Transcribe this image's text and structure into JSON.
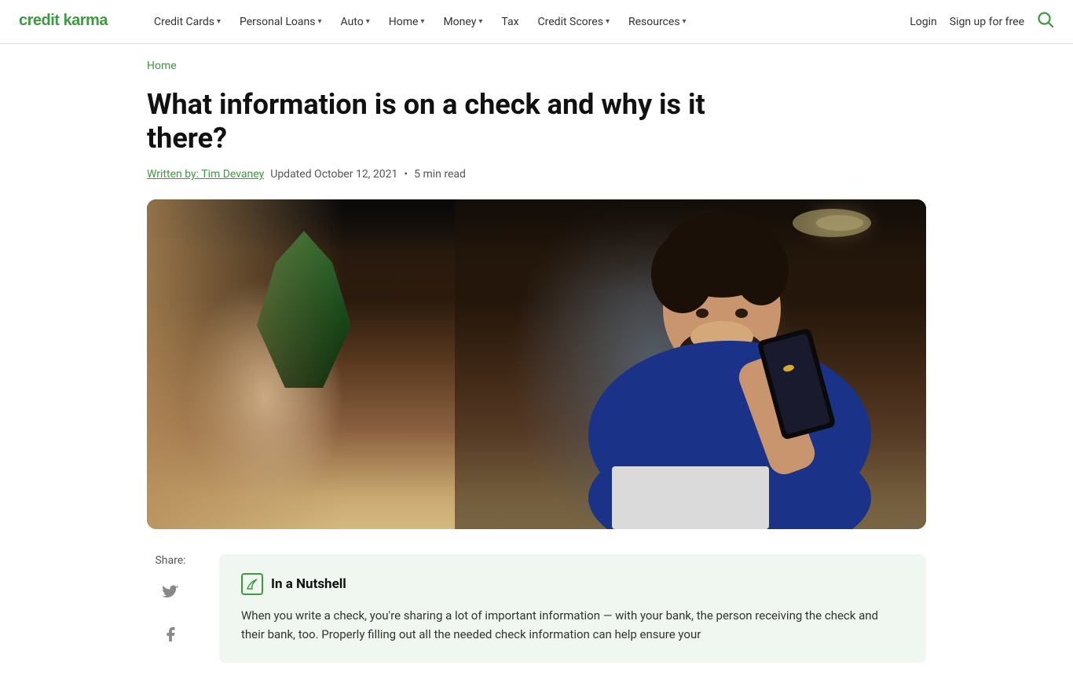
{
  "brand": {
    "name": "credit karma",
    "logo_text": "credit karma"
  },
  "nav": {
    "items": [
      {
        "label": "Credit Cards",
        "has_dropdown": true
      },
      {
        "label": "Personal Loans",
        "has_dropdown": true
      },
      {
        "label": "Auto",
        "has_dropdown": true
      },
      {
        "label": "Home",
        "has_dropdown": true
      },
      {
        "label": "Money",
        "has_dropdown": true
      },
      {
        "label": "Tax",
        "has_dropdown": false
      },
      {
        "label": "Credit Scores",
        "has_dropdown": true
      },
      {
        "label": "Resources",
        "has_dropdown": true
      }
    ],
    "login_label": "Login",
    "signup_label": "Sign up for free"
  },
  "breadcrumb": "Home",
  "article": {
    "title": "What information is on a check and why is it there?",
    "author_label": "Written by: Tim Devaney",
    "meta_updated": "Updated October 12, 2021",
    "meta_read": "5 min read"
  },
  "share": {
    "label": "Share:"
  },
  "nutshell": {
    "title": "In a Nutshell",
    "text": "When you write a check, you're sharing a lot of important information — with your bank, the person receiving the check and their bank, too. Properly filling out all the needed check information can help ensure your"
  },
  "icons": {
    "search": "🔍",
    "twitter": "🐦",
    "facebook": "f",
    "chevron": "▾"
  },
  "colors": {
    "green": "#3a9b3f",
    "dark_green": "#1a5c1e"
  }
}
